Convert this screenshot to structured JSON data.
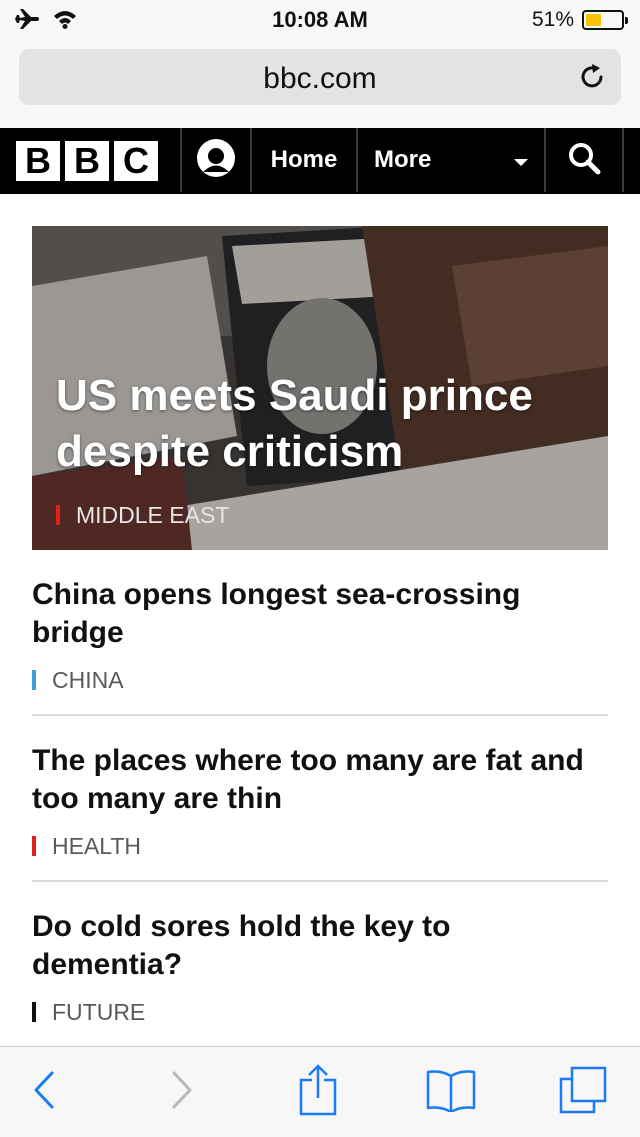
{
  "status_bar": {
    "time": "10:08 AM",
    "battery_percent": "51%",
    "battery_level": 0.51,
    "icons": [
      "airplane-icon",
      "wifi-icon",
      "battery-icon"
    ]
  },
  "browser": {
    "url": "bbc.com",
    "reload_icon": "reload-icon"
  },
  "bbc_nav": {
    "logo_letters": [
      "B",
      "B",
      "C"
    ],
    "account_icon": "account-icon",
    "home_label": "Home",
    "more_label": "More",
    "search_icon": "search-icon"
  },
  "hero": {
    "title": "US meets Saudi prince despite criticism",
    "tag": "MIDDLE EAST",
    "tag_color": "#e0201b"
  },
  "stories": [
    {
      "title": "China opens longest sea-crossing bridge",
      "tag": "CHINA",
      "tag_color": "#3f9ad8"
    },
    {
      "title": "The places where too many are fat and too many are thin",
      "tag": "HEALTH",
      "tag_color": "#e0201b"
    },
    {
      "title": "Do cold sores hold the key to dementia?",
      "tag": "FUTURE",
      "tag_color": "#111111"
    }
  ],
  "toolbar": {
    "icons": [
      "back-icon",
      "forward-icon",
      "share-icon",
      "bookmarks-icon",
      "tabs-icon"
    ],
    "accent_color": "#1a7cf5"
  },
  "colors": {
    "nav_bg": "#000000",
    "accent": "#1a7cf5"
  }
}
